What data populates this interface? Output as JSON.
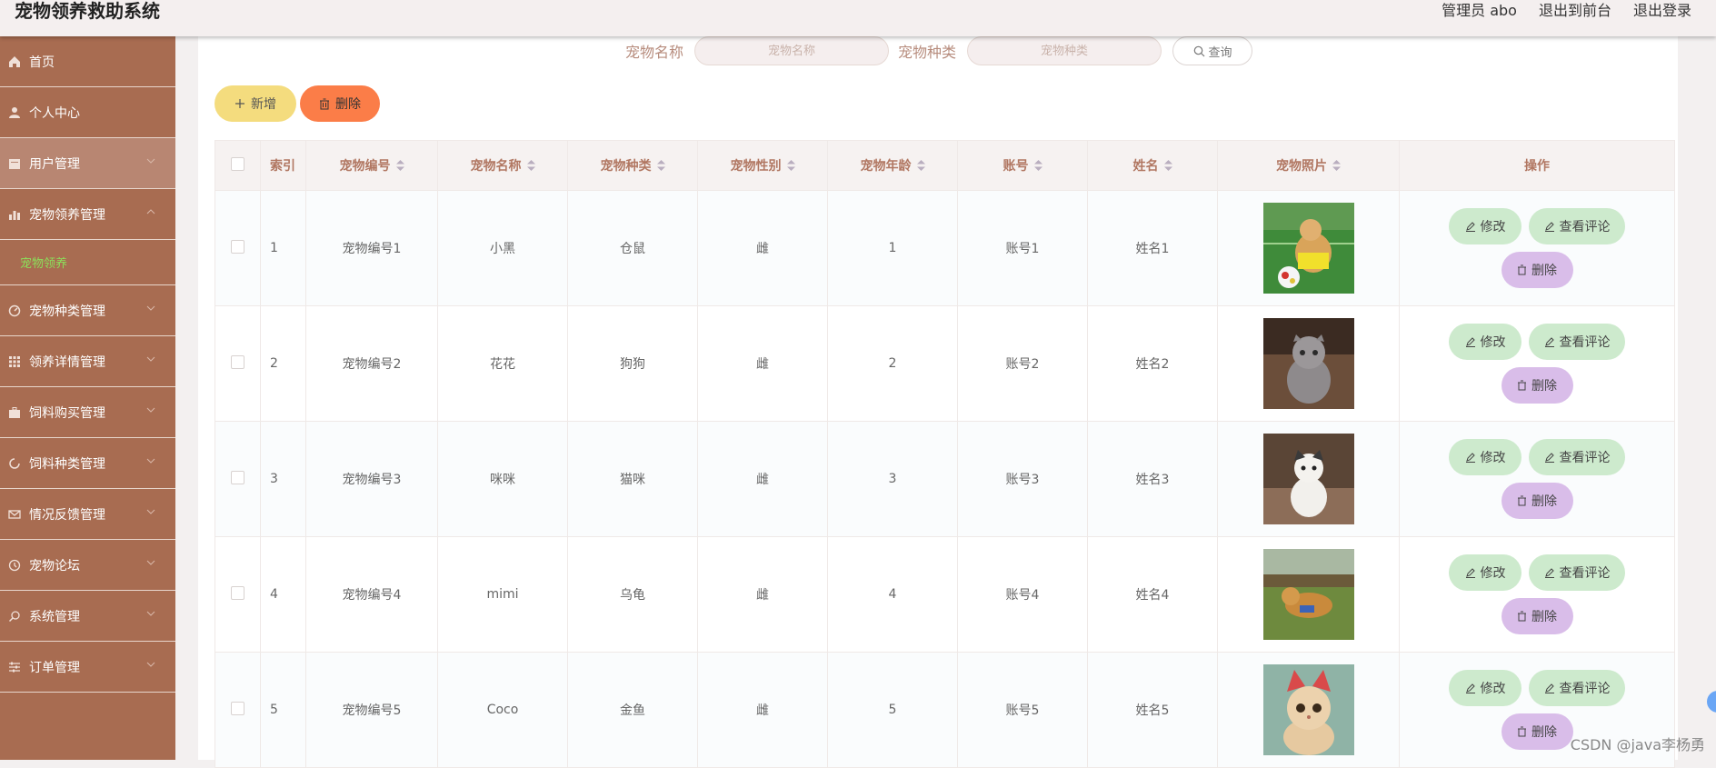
{
  "header": {
    "title": "宠物领养救助系统",
    "user": "管理员 abo",
    "to_front": "退出到前台",
    "logout": "退出登录"
  },
  "sidebar": {
    "items": [
      {
        "label": "首页",
        "icon": "home-icon"
      },
      {
        "label": "个人中心",
        "icon": "user-icon"
      },
      {
        "label": "用户管理",
        "icon": "calendar-icon"
      },
      {
        "label": "宠物领养管理",
        "icon": "bar-chart-icon",
        "expanded": true,
        "children": [
          "宠物领养"
        ]
      },
      {
        "label": "宠物种类管理",
        "icon": "gauge-icon"
      },
      {
        "label": "领养详情管理",
        "icon": "grid-icon"
      },
      {
        "label": "饲料购买管理",
        "icon": "briefcase-icon"
      },
      {
        "label": "饲料种类管理",
        "icon": "refresh-icon"
      },
      {
        "label": "情况反馈管理",
        "icon": "mail-icon"
      },
      {
        "label": "宠物论坛",
        "icon": "clock-icon"
      },
      {
        "label": "系统管理",
        "icon": "search-icon"
      },
      {
        "label": "订单管理",
        "icon": "sliders-icon"
      }
    ]
  },
  "search": {
    "name_label": "宠物名称",
    "name_placeholder": "宠物名称",
    "type_label": "宠物种类",
    "type_placeholder": "宠物种类",
    "query_label": "查询"
  },
  "actions": {
    "add_label": "新增",
    "delete_label": "删除"
  },
  "table": {
    "columns": [
      "索引",
      "宠物编号",
      "宠物名称",
      "宠物种类",
      "宠物性别",
      "宠物年龄",
      "账号",
      "姓名",
      "宠物照片",
      "操作"
    ],
    "rows": [
      {
        "index": "1",
        "code": "宠物编号1",
        "name": "小黑",
        "type": "仓鼠",
        "gender": "雌",
        "age": "1",
        "account": "账号1",
        "person": "姓名1",
        "photo": "dog-with-ball"
      },
      {
        "index": "2",
        "code": "宠物编号2",
        "name": "花花",
        "type": "狗狗",
        "gender": "雌",
        "age": "2",
        "account": "账号2",
        "person": "姓名2",
        "photo": "gray-kitten"
      },
      {
        "index": "3",
        "code": "宠物编号3",
        "name": "咪咪",
        "type": "猫咪",
        "gender": "雌",
        "age": "3",
        "account": "账号3",
        "person": "姓名3",
        "photo": "white-cat"
      },
      {
        "index": "4",
        "code": "宠物编号4",
        "name": "mimi",
        "type": "乌龟",
        "gender": "雌",
        "age": "4",
        "account": "账号4",
        "person": "姓名4",
        "photo": "running-dog"
      },
      {
        "index": "5",
        "code": "宠物编号5",
        "name": "Coco",
        "type": "金鱼",
        "gender": "雌",
        "age": "5",
        "account": "账号5",
        "person": "姓名5",
        "photo": "cat-with-hat"
      }
    ],
    "row_actions": {
      "edit": "修改",
      "review": "查看评论",
      "delete": "删除"
    }
  },
  "watermark": "CSDN @java李杨勇",
  "colors": {
    "sidebar": "#a86c51",
    "accent_submenu": "#8be05a",
    "add_button": "#f4dc7e",
    "delete_button": "#fb7d48",
    "edit_button": "#cdeacd",
    "row_delete_button": "#d9bde9"
  }
}
